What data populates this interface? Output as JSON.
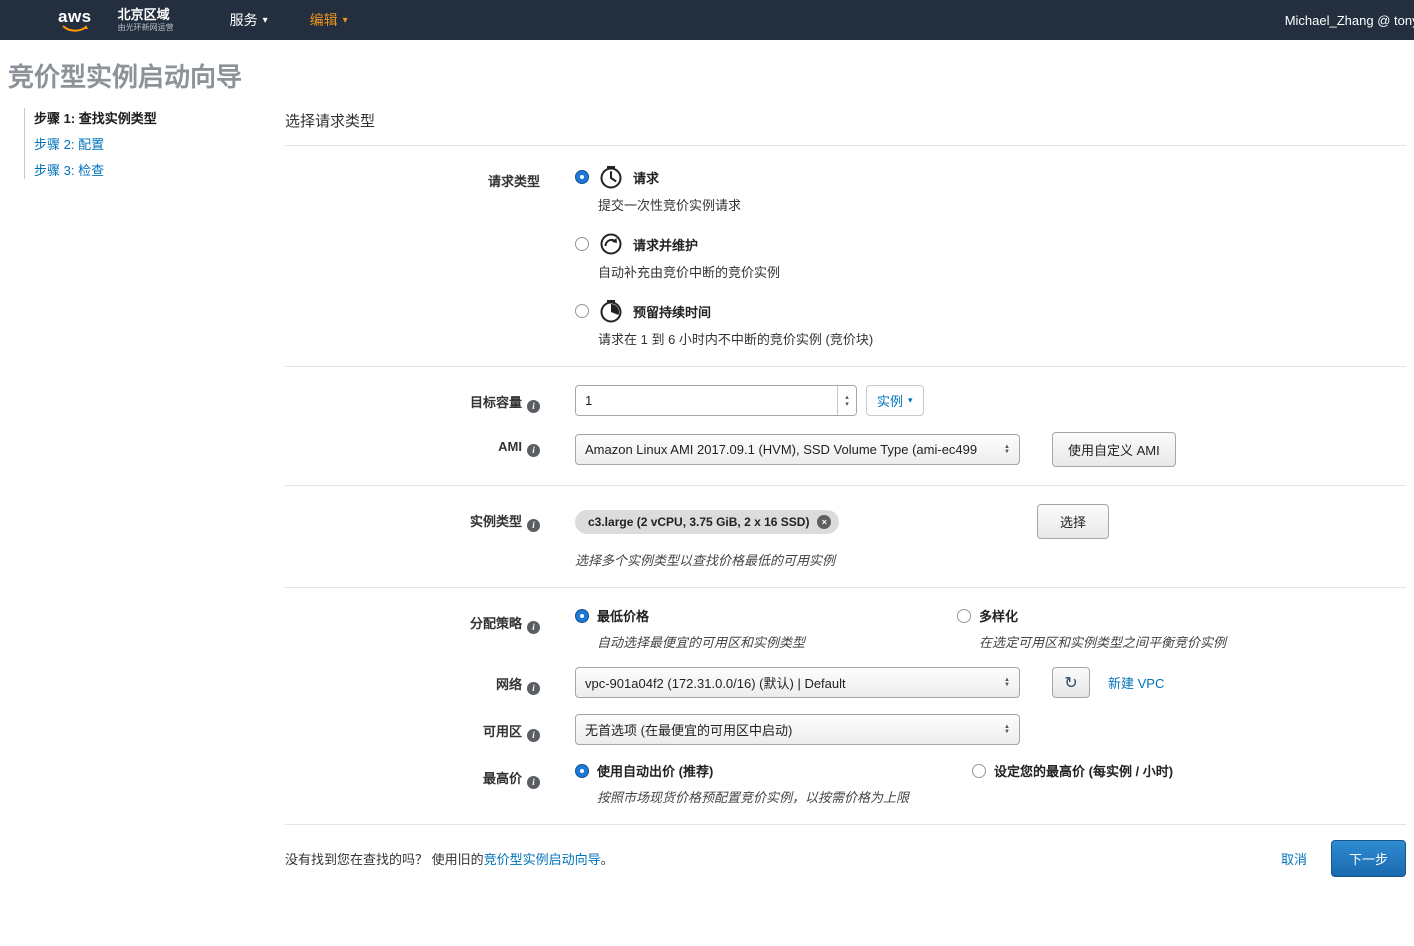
{
  "navbar": {
    "logo_text": "aws",
    "region": "北京区域",
    "region_operator": "由光环新网运营",
    "menu_services": "服务",
    "menu_edit": "编辑",
    "user": "Michael_Zhang @ tonyxi"
  },
  "page_title": "竞价型实例启动向导",
  "steps": [
    {
      "label": "步骤 1: 查找实例类型"
    },
    {
      "label": "步骤 2: 配置"
    },
    {
      "label": "步骤 3: 检查"
    }
  ],
  "section_title": "选择请求类型",
  "request_type": {
    "label": "请求类型",
    "options": [
      {
        "title": "请求",
        "desc": "提交一次性竞价实例请求"
      },
      {
        "title": "请求并维护",
        "desc": "自动补充由竞价中断的竞价实例"
      },
      {
        "title": "预留持续时间",
        "desc": "请求在 1 到 6 小时内不中断的竞价实例 (竞价块)"
      }
    ]
  },
  "target_capacity": {
    "label": "目标容量",
    "value": "1",
    "unit_button": "实例"
  },
  "ami": {
    "label": "AMI",
    "selected": "Amazon Linux AMI 2017.09.1 (HVM), SSD Volume Type (ami-ec499",
    "custom_button": "使用自定义 AMI"
  },
  "instance_type": {
    "label": "实例类型",
    "tag": "c3.large (2 vCPU, 3.75 GiB, 2 x 16 SSD)",
    "select_button": "选择",
    "hint": "选择多个实例类型以查找价格最低的可用实例"
  },
  "allocation_strategy": {
    "label": "分配策略",
    "options": [
      {
        "title": "最低价格",
        "desc": "自动选择最便宜的可用区和实例类型"
      },
      {
        "title": "多样化",
        "desc": "在选定可用区和实例类型之间平衡竞价实例"
      }
    ]
  },
  "network": {
    "label": "网络",
    "selected": "vpc-901a04f2 (172.31.0.0/16) (默认) | Default",
    "new_vpc_link": "新建 VPC"
  },
  "availability_zone": {
    "label": "可用区",
    "selected": "无首选项 (在最便宜的可用区中启动)"
  },
  "max_price": {
    "label": "最高价",
    "options": [
      {
        "title": "使用自动出价 (推荐)",
        "desc": "按照市场现货价格预配置竞价实例，以按需价格为上限"
      },
      {
        "title": "设定您的最高价 (每实例 / 小时)"
      }
    ]
  },
  "footer": {
    "question_prefix": "没有找到您在查找的吗？ 使用旧的",
    "old_wizard_link": "竞价型实例启动向导",
    "question_suffix": "。",
    "cancel": "取消",
    "next": "下一步"
  },
  "icons": {
    "caret_down": "▾",
    "spinner_up": "▴",
    "spinner_down": "▾",
    "select_up": "▲",
    "select_down": "▼",
    "refresh": "↻",
    "close": "×",
    "info": "i"
  },
  "colors": {
    "navbar_bg": "#232f3e",
    "link": "#0073bb",
    "accent_orange": "#ff9900",
    "primary_button": "#1a6aae"
  }
}
